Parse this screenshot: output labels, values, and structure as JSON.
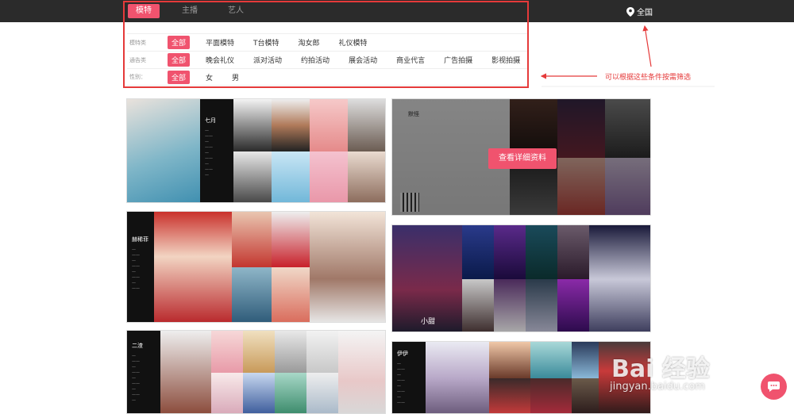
{
  "tabs": [
    {
      "label": "模特",
      "active": true
    },
    {
      "label": "主播",
      "active": false
    },
    {
      "label": "艺人",
      "active": false
    }
  ],
  "location": {
    "label": "全国",
    "icon": "location-pin-icon"
  },
  "filters": [
    {
      "label": "模特类",
      "options": [
        "全部",
        "平面模特",
        "T台模特",
        "淘女郎",
        "礼仪模特"
      ],
      "selected": "全部"
    },
    {
      "label": "通告类",
      "options": [
        "全部",
        "晚会礼仪",
        "派对活动",
        "约拍活动",
        "展会活动",
        "商业代言",
        "广告拍摄",
        "影视拍摄"
      ],
      "selected": "全部"
    },
    {
      "label": "性别：",
      "options": [
        "全部",
        "女",
        "男"
      ],
      "selected": "全部"
    }
  ],
  "annotation": "可以根据这些条件按需筛选",
  "cards": {
    "c1_name": "七月",
    "c2_name": "默怪",
    "c2_button": "查看详细资料",
    "c3_name": "赫稀菲",
    "c4_name": "小甜",
    "c5_name": "二渣",
    "c6_name": "伊伊"
  },
  "watermark": {
    "line1": "Bai 经验",
    "line2": "jingyan.baidu.com"
  },
  "colors": {
    "accent": "#f0536e",
    "topbar": "#2b2b2b",
    "annotation": "#e53a3a"
  }
}
